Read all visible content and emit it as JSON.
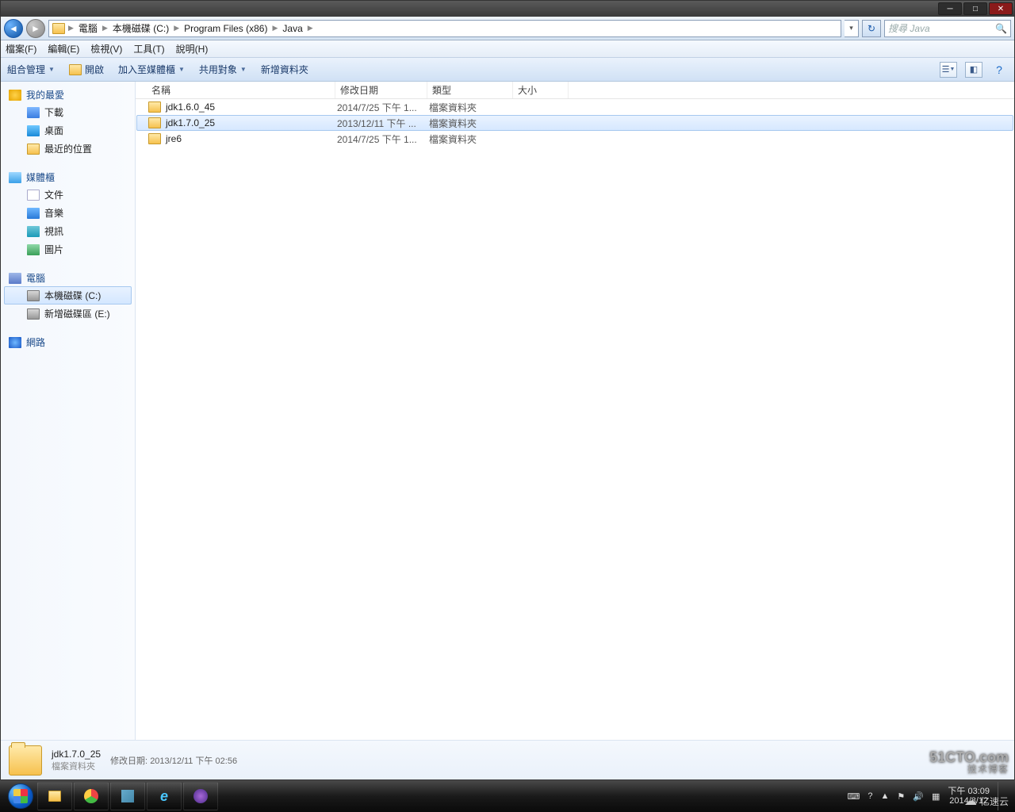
{
  "titlebar": {
    "min": "─",
    "max": "□",
    "close": "✕"
  },
  "nav": {
    "segments": [
      "電腦",
      "本機磁碟 (C:)",
      "Program Files (x86)",
      "Java"
    ],
    "search_placeholder": "搜尋 Java"
  },
  "menu": {
    "file": "檔案(F)",
    "edit": "編輯(E)",
    "view": "檢視(V)",
    "tools": "工具(T)",
    "help": "說明(H)"
  },
  "toolbar": {
    "organize": "組合管理",
    "open": "開啟",
    "addlib": "加入至媒體櫃",
    "share": "共用對象",
    "newfolder": "新增資料夾"
  },
  "sidebar": {
    "fav": "我的最愛",
    "dl": "下載",
    "desk": "桌面",
    "recent": "最近的位置",
    "lib": "媒體櫃",
    "doc": "文件",
    "music": "音樂",
    "video": "視訊",
    "pic": "圖片",
    "pc": "電腦",
    "drivec": "本機磁碟 (C:)",
    "drivee": "新增磁碟區 (E:)",
    "net": "網路"
  },
  "columns": {
    "name": "名稱",
    "date": "修改日期",
    "type": "類型",
    "size": "大小"
  },
  "files": [
    {
      "name": "jdk1.6.0_45",
      "date": "2014/7/25 下午 1...",
      "type": "檔案資料夾",
      "selected": false
    },
    {
      "name": "jdk1.7.0_25",
      "date": "2013/12/11 下午 ...",
      "type": "檔案資料夾",
      "selected": true
    },
    {
      "name": "jre6",
      "date": "2014/7/25 下午 1...",
      "type": "檔案資料夾",
      "selected": false
    }
  ],
  "details": {
    "name": "jdk1.7.0_25",
    "typelabel": "檔案資料夾",
    "metakey": "修改日期:",
    "metaval": "2013/12/11 下午 02:56"
  },
  "tray": {
    "time": "下午 03:09",
    "date": "2014/8/12"
  },
  "watermark": {
    "line1": "51CTO.com",
    "line2": "技术博客"
  },
  "watermark2": "亿速云"
}
